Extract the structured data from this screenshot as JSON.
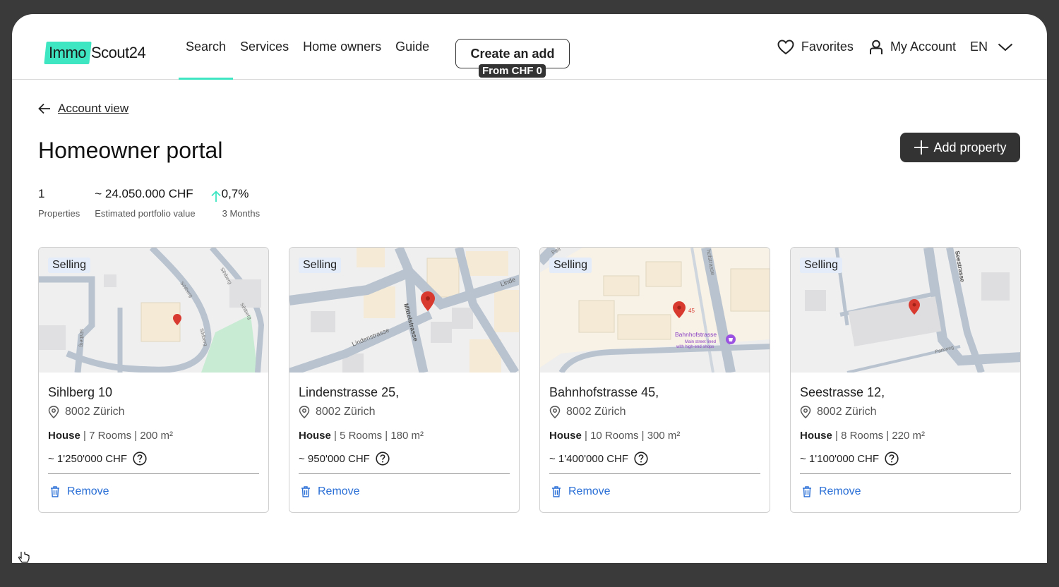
{
  "header": {
    "logo_part1": "Immo",
    "logo_part2": "Scout24",
    "nav": [
      {
        "label": "Search",
        "active": true
      },
      {
        "label": "Services"
      },
      {
        "label": "Home owners"
      },
      {
        "label": "Guide"
      }
    ],
    "cta_label": "Create an add",
    "cta_badge": "From CHF 0",
    "favorites": "Favorites",
    "account": "My Account",
    "language": "EN"
  },
  "back_link": "Account view",
  "page_title": "Homeowner portal",
  "add_button": "Add property",
  "stats": {
    "properties_value": "1",
    "properties_label": "Properties",
    "portfolio_value": "~ 24.050.000 CHF",
    "portfolio_label": "Estimated portfolio value",
    "change_value": "0,7%",
    "change_label": "3 Months"
  },
  "colors": {
    "accent": "#3ee6c2",
    "dark": "#333333",
    "link": "#2a6fd6",
    "pin": "#d93a30"
  },
  "properties": [
    {
      "status": "Selling",
      "address": "Sihlberg 10",
      "city": "8002 Zürich",
      "type": "House",
      "rooms": "7 Rooms",
      "area": "200 m²",
      "price": "~ 1'250'000 CHF",
      "remove": "Remove"
    },
    {
      "status": "Selling",
      "address": "Lindenstrasse 25,",
      "city": "8002 Zürich",
      "type": "House",
      "rooms": "5 Rooms",
      "area": "180 m²",
      "price": "~ 950'000 CHF",
      "remove": "Remove"
    },
    {
      "status": "Selling",
      "address": "Bahnhofstrasse 45,",
      "city": "8002 Zürich",
      "type": "House",
      "rooms": "10 Rooms",
      "area": "300 m²",
      "price": "~ 1'400'000 CHF",
      "remove": "Remove"
    },
    {
      "status": "Selling",
      "address": "Seestrasse 12,",
      "city": "8002 Zürich",
      "type": "House",
      "rooms": "8 Rooms",
      "area": "220 m²",
      "price": "~ 1'100'000 CHF",
      "remove": "Remove"
    }
  ],
  "map_labels": {
    "map1": [
      "Sihlberg",
      "Sihlberg",
      "Sihlberg",
      "Sihlberg",
      "Sihlberg"
    ],
    "map2": [
      "Lindenstrasse",
      "Mittelstrasse",
      "Linde"
    ],
    "map3": [
      "Bahnhofstrasse",
      "Main street lined",
      "with high-end shops",
      "45",
      "hofstrasse",
      "Peli"
    ],
    "map4": [
      "Seestrasse",
      "Parkweg"
    ]
  }
}
